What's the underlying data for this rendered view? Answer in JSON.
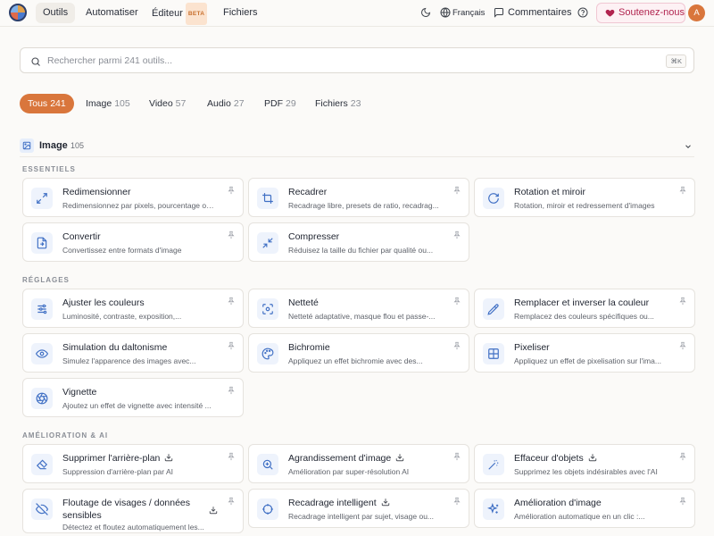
{
  "nav": {
    "items": [
      {
        "label": "Outils",
        "active": true
      },
      {
        "label": "Automatiser"
      },
      {
        "label": "Éditeur",
        "badge": "BETA"
      },
      {
        "label": "Fichiers"
      }
    ],
    "language": "Français",
    "comments": "Commentaires",
    "support": "Soutenez-nous",
    "avatar": "A"
  },
  "search": {
    "placeholder": "Rechercher parmi 241 outils...",
    "shortcut": "⌘K"
  },
  "filters": [
    {
      "label": "Tous",
      "count": "241",
      "active": true
    },
    {
      "label": "Image",
      "count": "105"
    },
    {
      "label": "Video",
      "count": "57"
    },
    {
      "label": "Audio",
      "count": "27"
    },
    {
      "label": "PDF",
      "count": "29"
    },
    {
      "label": "Fichiers",
      "count": "23"
    }
  ],
  "category": {
    "title": "Image",
    "count": "105"
  },
  "sections": [
    {
      "label": "ESSENTIELS",
      "tools": [
        {
          "title": "Redimensionner",
          "desc": "Redimensionnez par pixels, pourcentage ou...",
          "icon": "resize-icon"
        },
        {
          "title": "Recadrer",
          "desc": "Recadrage libre, presets de ratio, recadrag...",
          "icon": "crop-icon"
        },
        {
          "title": "Rotation et miroir",
          "desc": "Rotation, miroir et redressement d'images",
          "icon": "rotate-icon"
        },
        {
          "title": "Convertir",
          "desc": "Convertissez entre formats d'image",
          "icon": "convert-icon"
        },
        {
          "title": "Compresser",
          "desc": "Réduisez la taille du fichier par qualité ou...",
          "icon": "compress-icon"
        }
      ]
    },
    {
      "label": "RÉGLAGES",
      "tools": [
        {
          "title": "Ajuster les couleurs",
          "desc": "Luminosité, contraste, exposition,...",
          "icon": "sliders-icon"
        },
        {
          "title": "Netteté",
          "desc": "Netteté adaptative, masque flou et passe-...",
          "icon": "focus-icon"
        },
        {
          "title": "Remplacer et inverser la couleur",
          "desc": "Remplacez des couleurs spécifiques ou...",
          "icon": "eyedropper-icon"
        },
        {
          "title": "Simulation du daltonisme",
          "desc": "Simulez l'apparence des images avec...",
          "icon": "eye-icon"
        },
        {
          "title": "Bichromie",
          "desc": "Appliquez un effet bichromie avec des...",
          "icon": "palette-icon"
        },
        {
          "title": "Pixeliser",
          "desc": "Appliquez un effet de pixelisation sur l'ima...",
          "icon": "grid-icon"
        },
        {
          "title": "Vignette",
          "desc": "Ajoutez un effet de vignette avec intensité ...",
          "icon": "aperture-icon"
        }
      ]
    },
    {
      "label": "AMÉLIORATION & AI",
      "tools": [
        {
          "title": "Supprimer l'arrière-plan",
          "desc": "Suppression d'arrière-plan par AI",
          "icon": "eraser-icon"
        },
        {
          "title": "Agrandissement d'image",
          "desc": "Amélioration par super-résolution AI",
          "icon": "zoom-in-icon"
        },
        {
          "title": "Effaceur d'objets",
          "desc": "Supprimez les objets indésirables avec l'AI",
          "icon": "magic-wand-icon"
        },
        {
          "title": "Floutage de visages / données sensibles",
          "desc": "Détectez et floutez automatiquement les...",
          "icon": "eye-off-icon"
        },
        {
          "title": "Recadrage intelligent",
          "desc": "Recadrage intelligent par sujet, visage ou...",
          "icon": "target-icon"
        },
        {
          "title": "Amélioration d'image",
          "desc": "Amélioration automatique en un clic :...",
          "icon": "sparkles-icon"
        }
      ]
    }
  ]
}
